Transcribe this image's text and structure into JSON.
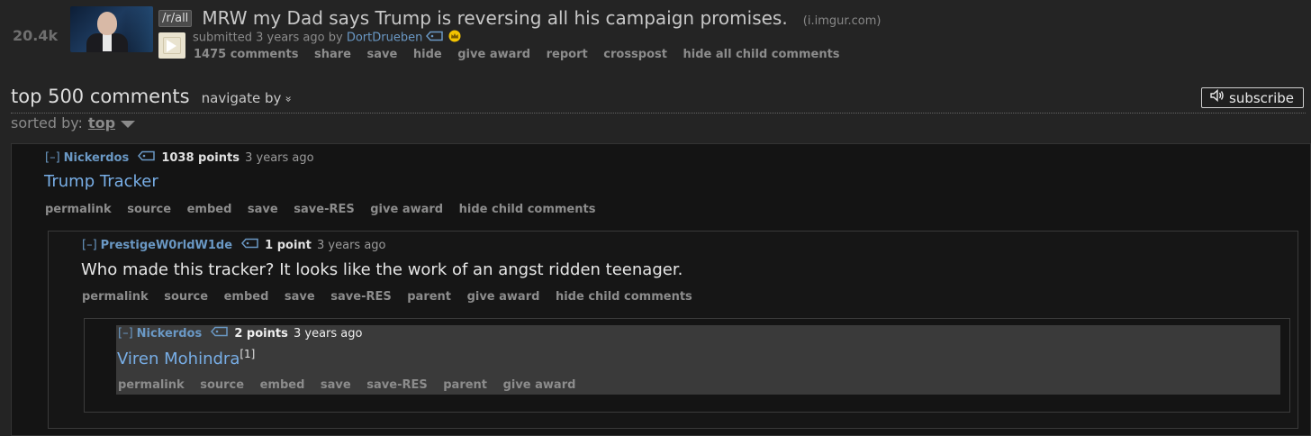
{
  "post": {
    "score": "20.4k",
    "subreddit_tag": "/r/all",
    "title": "MRW my Dad says Trump is reversing all his campaign promises.",
    "domain": "(i.imgur.com)",
    "submitted_prefix": "submitted 3 years ago by",
    "author": "DortDrueben",
    "buttons": [
      "1475 comments",
      "share",
      "save",
      "hide",
      "give award",
      "report",
      "crosspost",
      "hide all child comments"
    ]
  },
  "comments_header": {
    "title": "top 500 comments",
    "navigate": "navigate by",
    "navigate_glyph": "»",
    "subscribe": "subscribe",
    "sorted_label": "sorted by:",
    "sorted_value": "top"
  },
  "comments": [
    {
      "expand": "[–]",
      "author": "Nickerdos",
      "points": "1038 points",
      "age": "3 years ago",
      "body": "Trump Tracker",
      "buttons": [
        "permalink",
        "source",
        "embed",
        "save",
        "save-RES",
        "give award",
        "hide child comments"
      ]
    },
    {
      "expand": "[–]",
      "author": "PrestigeW0rldW1de",
      "points": "1 point",
      "age": "3 years ago",
      "body": "Who made this tracker? It looks like the work of an angst ridden teenager.",
      "buttons": [
        "permalink",
        "source",
        "embed",
        "save",
        "save-RES",
        "parent",
        "give award",
        "hide child comments"
      ]
    },
    {
      "expand": "[–]",
      "author": "Nickerdos",
      "points": "2 points",
      "age": "3 years ago",
      "body": "Viren Mohindra",
      "footnote": "[1]",
      "buttons": [
        "permalink",
        "source",
        "embed",
        "save",
        "save-RES",
        "parent",
        "give award"
      ]
    }
  ],
  "icons": [
    "tag-icon",
    "crown-icon",
    "speaker-icon",
    "play-icon"
  ]
}
